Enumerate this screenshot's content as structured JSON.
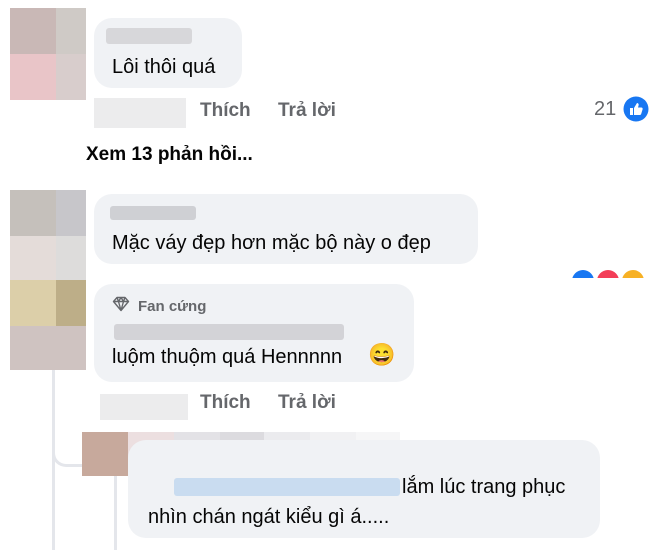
{
  "comments": [
    {
      "text": "Lôi thôi quá",
      "like_label": "Thích",
      "reply_label": "Trả lời",
      "reaction_count": "21"
    },
    {
      "view_replies_label": "Xem 13 phản hồi..."
    },
    {
      "text": "Mặc váy đẹp hơn  mặc bộ này o đẹp"
    },
    {
      "badge_label": "Fan cứng",
      "text": "luộm thuộm quá Hennnnn",
      "emoji": "😄",
      "like_label": "Thích",
      "reply_label": "Trả lời"
    },
    {
      "text_line1": "lắm lúc trang phục",
      "text_line2": "nhìn chán ngát kiểu gì á....."
    }
  ],
  "colors": {
    "bubble_bg": "#f0f2f5",
    "action_gray": "#65676b",
    "like_blue": "#1877f2"
  },
  "icons": [
    "like-thumb-icon",
    "diamond-icon",
    "grinning-emoji-icon"
  ]
}
